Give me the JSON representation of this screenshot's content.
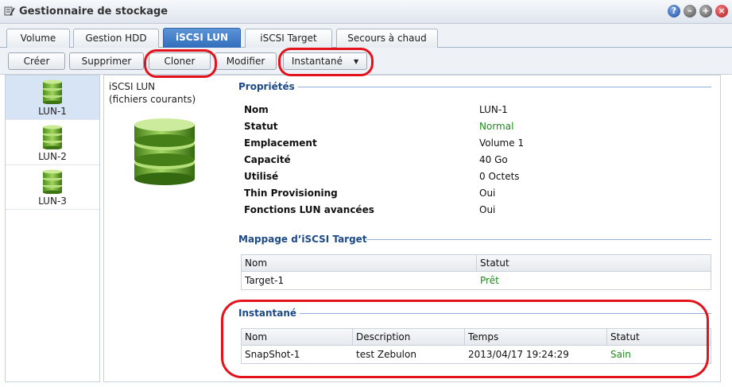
{
  "window": {
    "title": "Gestionnaire de stockage"
  },
  "tabs": [
    {
      "label": "Volume",
      "active": false
    },
    {
      "label": "Gestion HDD",
      "active": false
    },
    {
      "label": "iSCSI LUN",
      "active": true
    },
    {
      "label": "iSCSI Target",
      "active": false
    },
    {
      "label": "Secours à chaud",
      "active": false
    }
  ],
  "toolbar": {
    "create": "Créer",
    "delete": "Supprimer",
    "clone": "Cloner",
    "modify": "Modifier",
    "snapshot": "Instantané"
  },
  "sidebar": {
    "items": [
      {
        "label": "LUN-1"
      },
      {
        "label": "LUN-2"
      },
      {
        "label": "LUN-3"
      }
    ]
  },
  "details": {
    "type_line1": "iSCSI LUN",
    "type_line2": "(fichiers courants)",
    "properties_title": "Propriétés",
    "properties": [
      {
        "label": "Nom",
        "value": "LUN-1"
      },
      {
        "label": "Statut",
        "value": "Normal"
      },
      {
        "label": "Emplacement",
        "value": "Volume 1"
      },
      {
        "label": "Capacité",
        "value": "40 Go"
      },
      {
        "label": "Utilisé",
        "value": "0 Octets"
      },
      {
        "label": "Thin Provisioning",
        "value": "Oui"
      },
      {
        "label": "Fonctions LUN avancées",
        "value": "Oui"
      }
    ],
    "mapping_title": "Mappage d’iSCSI Target",
    "mapping_columns": [
      "Nom",
      "Statut"
    ],
    "mapping_rows": [
      [
        "Target-1",
        "Prêt"
      ]
    ],
    "snapshot_title": "Instantané",
    "snapshot_columns": [
      "Nom",
      "Description",
      "Temps",
      "Statut"
    ],
    "snapshot_rows": [
      [
        "SnapShot-1",
        "test Zebulon",
        "2013/04/17 19:24:29",
        "Sain"
      ]
    ]
  },
  "colors": {
    "accent": "#2f6cb9",
    "section": "#1c4a86",
    "ok": "#1e8a1e",
    "annotation": "#e3121b"
  }
}
